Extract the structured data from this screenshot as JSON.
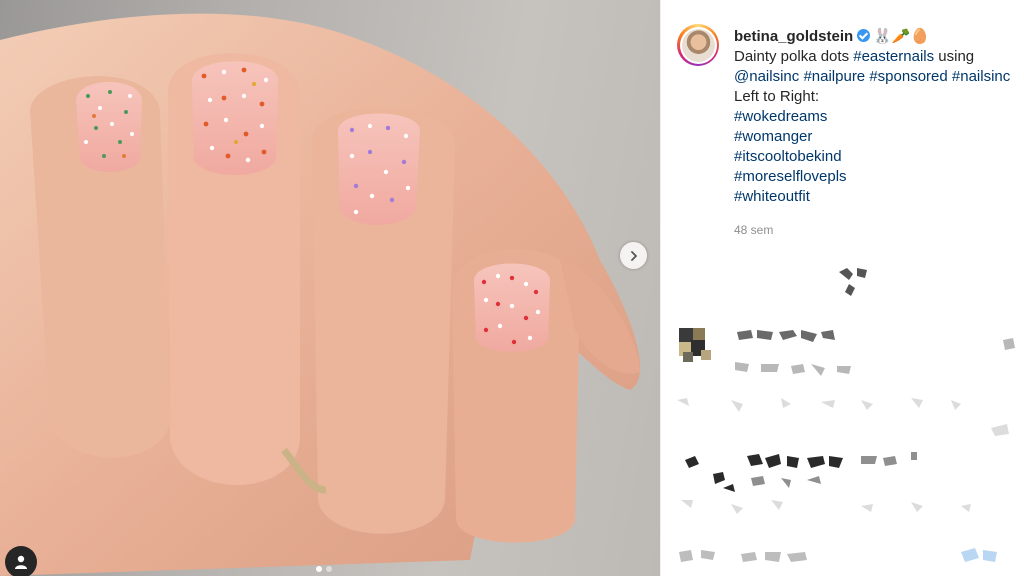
{
  "post": {
    "username": "betina_goldstein",
    "verified": true,
    "username_emoji": "🐰🥕🥚",
    "caption_prefix": "Dainty polka dots ",
    "caption_tag": "#easternails",
    "caption_suffix": " using",
    "caption_line2_tags": [
      "@nailsinc",
      "#nailpure",
      "#sponsored",
      "#nailsinc"
    ],
    "caption_line3": "Left to Right:",
    "shade_tags": [
      "#wokedreams",
      "#womanger",
      "#itscooltobekind",
      "#moreselflovepls",
      "#whiteoutfit"
    ],
    "time": "48 sem"
  },
  "media": {
    "carousel_count": 2,
    "carousel_active": 1,
    "icons": {
      "next": "chevron-right-icon",
      "user_tags": "user-icon"
    }
  },
  "colors": {
    "link": "#00376b",
    "muted": "#8e8e8e",
    "text": "#262626",
    "verified": "#3897f0"
  }
}
